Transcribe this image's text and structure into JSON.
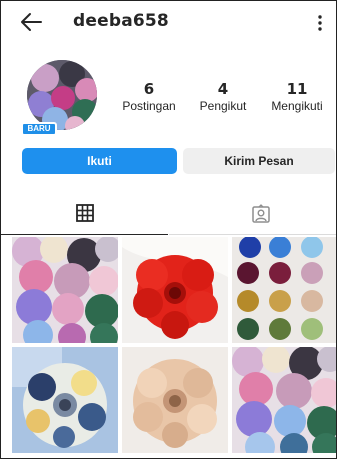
{
  "header": {
    "username": "deeba658"
  },
  "profile": {
    "badge": "BARU",
    "stats": [
      {
        "value": "6",
        "label": "Postingan"
      },
      {
        "value": "4",
        "label": "Pengikut"
      },
      {
        "value": "11",
        "label": "Mengikuti"
      }
    ]
  },
  "actions": {
    "follow_label": "Ikuti",
    "message_label": "Kirim Pesan"
  },
  "tabs": [
    {
      "icon": "grid-icon",
      "active": true
    },
    {
      "icon": "tagged-person-icon",
      "active": false
    }
  ],
  "posts": [
    {
      "icon": "scrunchie-collection-photo"
    },
    {
      "icon": "red-scrunchie-photo"
    },
    {
      "icon": "scrunchie-grid-photo"
    },
    {
      "icon": "floral-scrunchie-photo"
    },
    {
      "icon": "beige-scrunchie-photo"
    },
    {
      "icon": "scrunchie-collection-photo"
    }
  ],
  "colors": {
    "accent": "#1e90ee",
    "secondary_button": "#efefef",
    "text": "#262626"
  }
}
